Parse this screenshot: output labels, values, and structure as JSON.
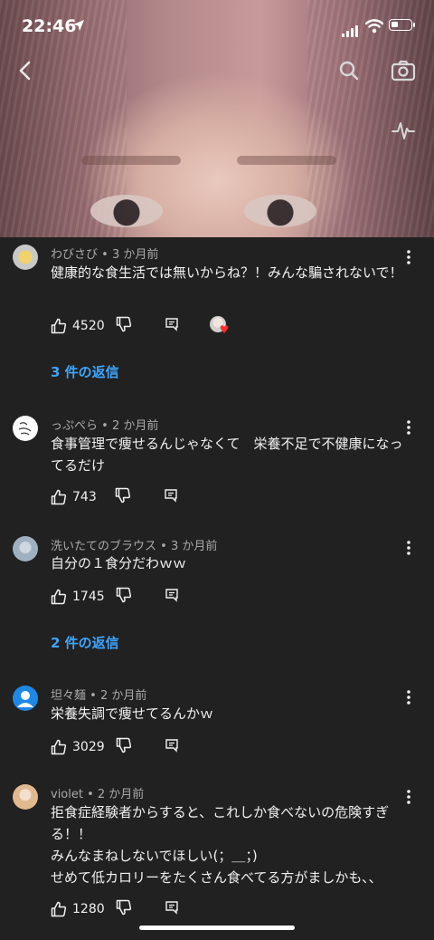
{
  "status": {
    "time": "22:46"
  },
  "comments": [
    {
      "author": "わびさび",
      "age": "3 か月前",
      "text": "健康的な食生活では無いからね？！みんな騙されないで！",
      "likes": "4520"
    },
    {
      "author": "っぷぺら",
      "age": "2 か月前",
      "text": "食事管理で痩せるんじゃなくて　栄養不足で不健康になってるだけ",
      "likes": "743"
    },
    {
      "author": "洗いたてのブラウス",
      "age": "3 か月前",
      "text": "自分の１食分だわｗｗ",
      "likes": "1745"
    },
    {
      "author": "坦々麺",
      "age": "2 か月前",
      "text": "栄養失調で痩せてるんかｗ",
      "likes": "3029"
    },
    {
      "author": "violet",
      "age": "2 か月前",
      "text_lines": [
        "拒食症経験者からすると、これしか食べないの危険すぎる！！",
        "みんなまねしないでほしい(；＿；)",
        "せめて低カロリーをたくさん食べてる方がましかも、、"
      ],
      "likes": "1280"
    }
  ],
  "replies": [
    {
      "label": "3 件の返信"
    },
    {
      "label": "2 件の返信"
    }
  ],
  "meta_separator": " • ",
  "icons": {
    "back": "chevron-left-icon",
    "search": "search-icon",
    "camera": "camera-icon",
    "pulse": "activity-icon",
    "like": "thumbs-up-icon",
    "dislike": "thumbs-down-icon",
    "reply": "reply-comment-icon",
    "more": "more-vertical-icon"
  },
  "colors": {
    "background": "#212121",
    "link": "#3ea6ff",
    "meta": "#aaaaaa",
    "text": "#f1f1f1"
  }
}
